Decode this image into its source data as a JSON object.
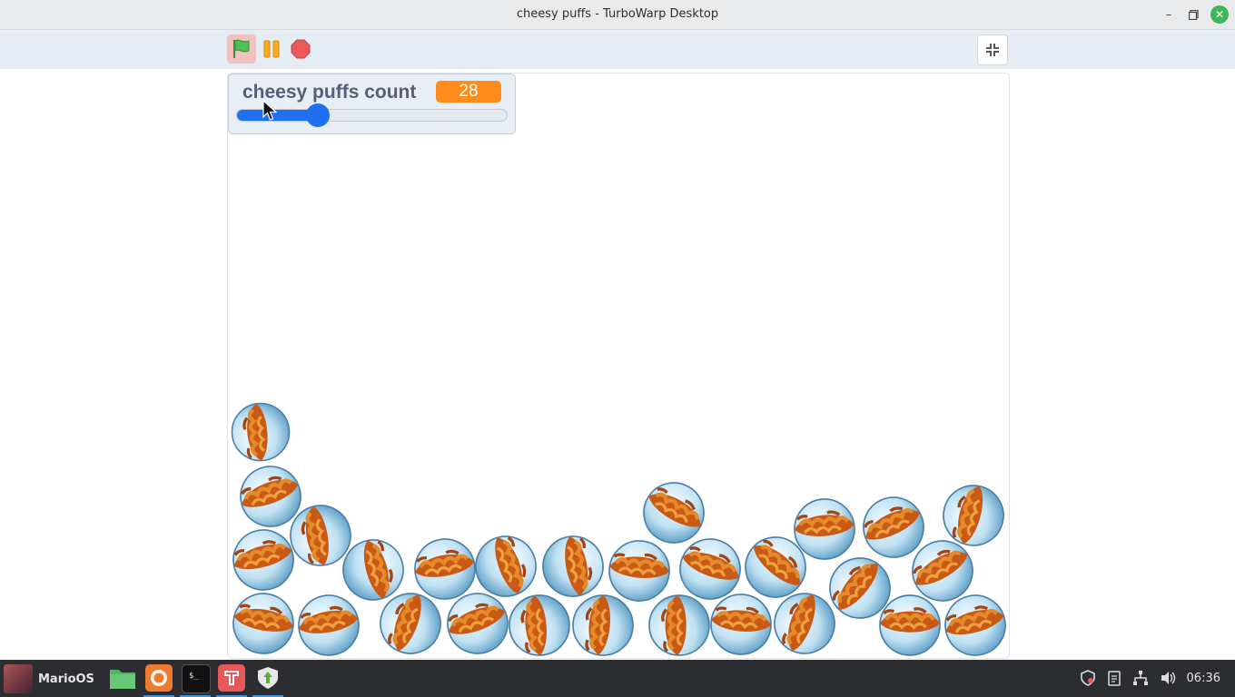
{
  "window": {
    "title": "cheesy puffs - TurboWarp Desktop"
  },
  "toolbar": {
    "green_flag": "green-flag-icon",
    "pause": "pause-icon",
    "stop": "stop-icon",
    "fullscreen": "exit-fullscreen-icon"
  },
  "monitor": {
    "label": "cheesy puffs count",
    "value": "28",
    "slider_fraction": 0.3
  },
  "taskbar": {
    "start_label": "MarioOS",
    "apps": [
      "files-icon",
      "firefox-icon",
      "terminal-icon",
      "turbowarp-icon",
      "update-manager-icon"
    ],
    "clock": "06:36"
  },
  "colors": {
    "flag_bg": "#f2c2c2",
    "monitor_value_bg": "#ff8c1a",
    "slider": "#1e6ff2",
    "taskbar_bg": "#2b2d30"
  }
}
